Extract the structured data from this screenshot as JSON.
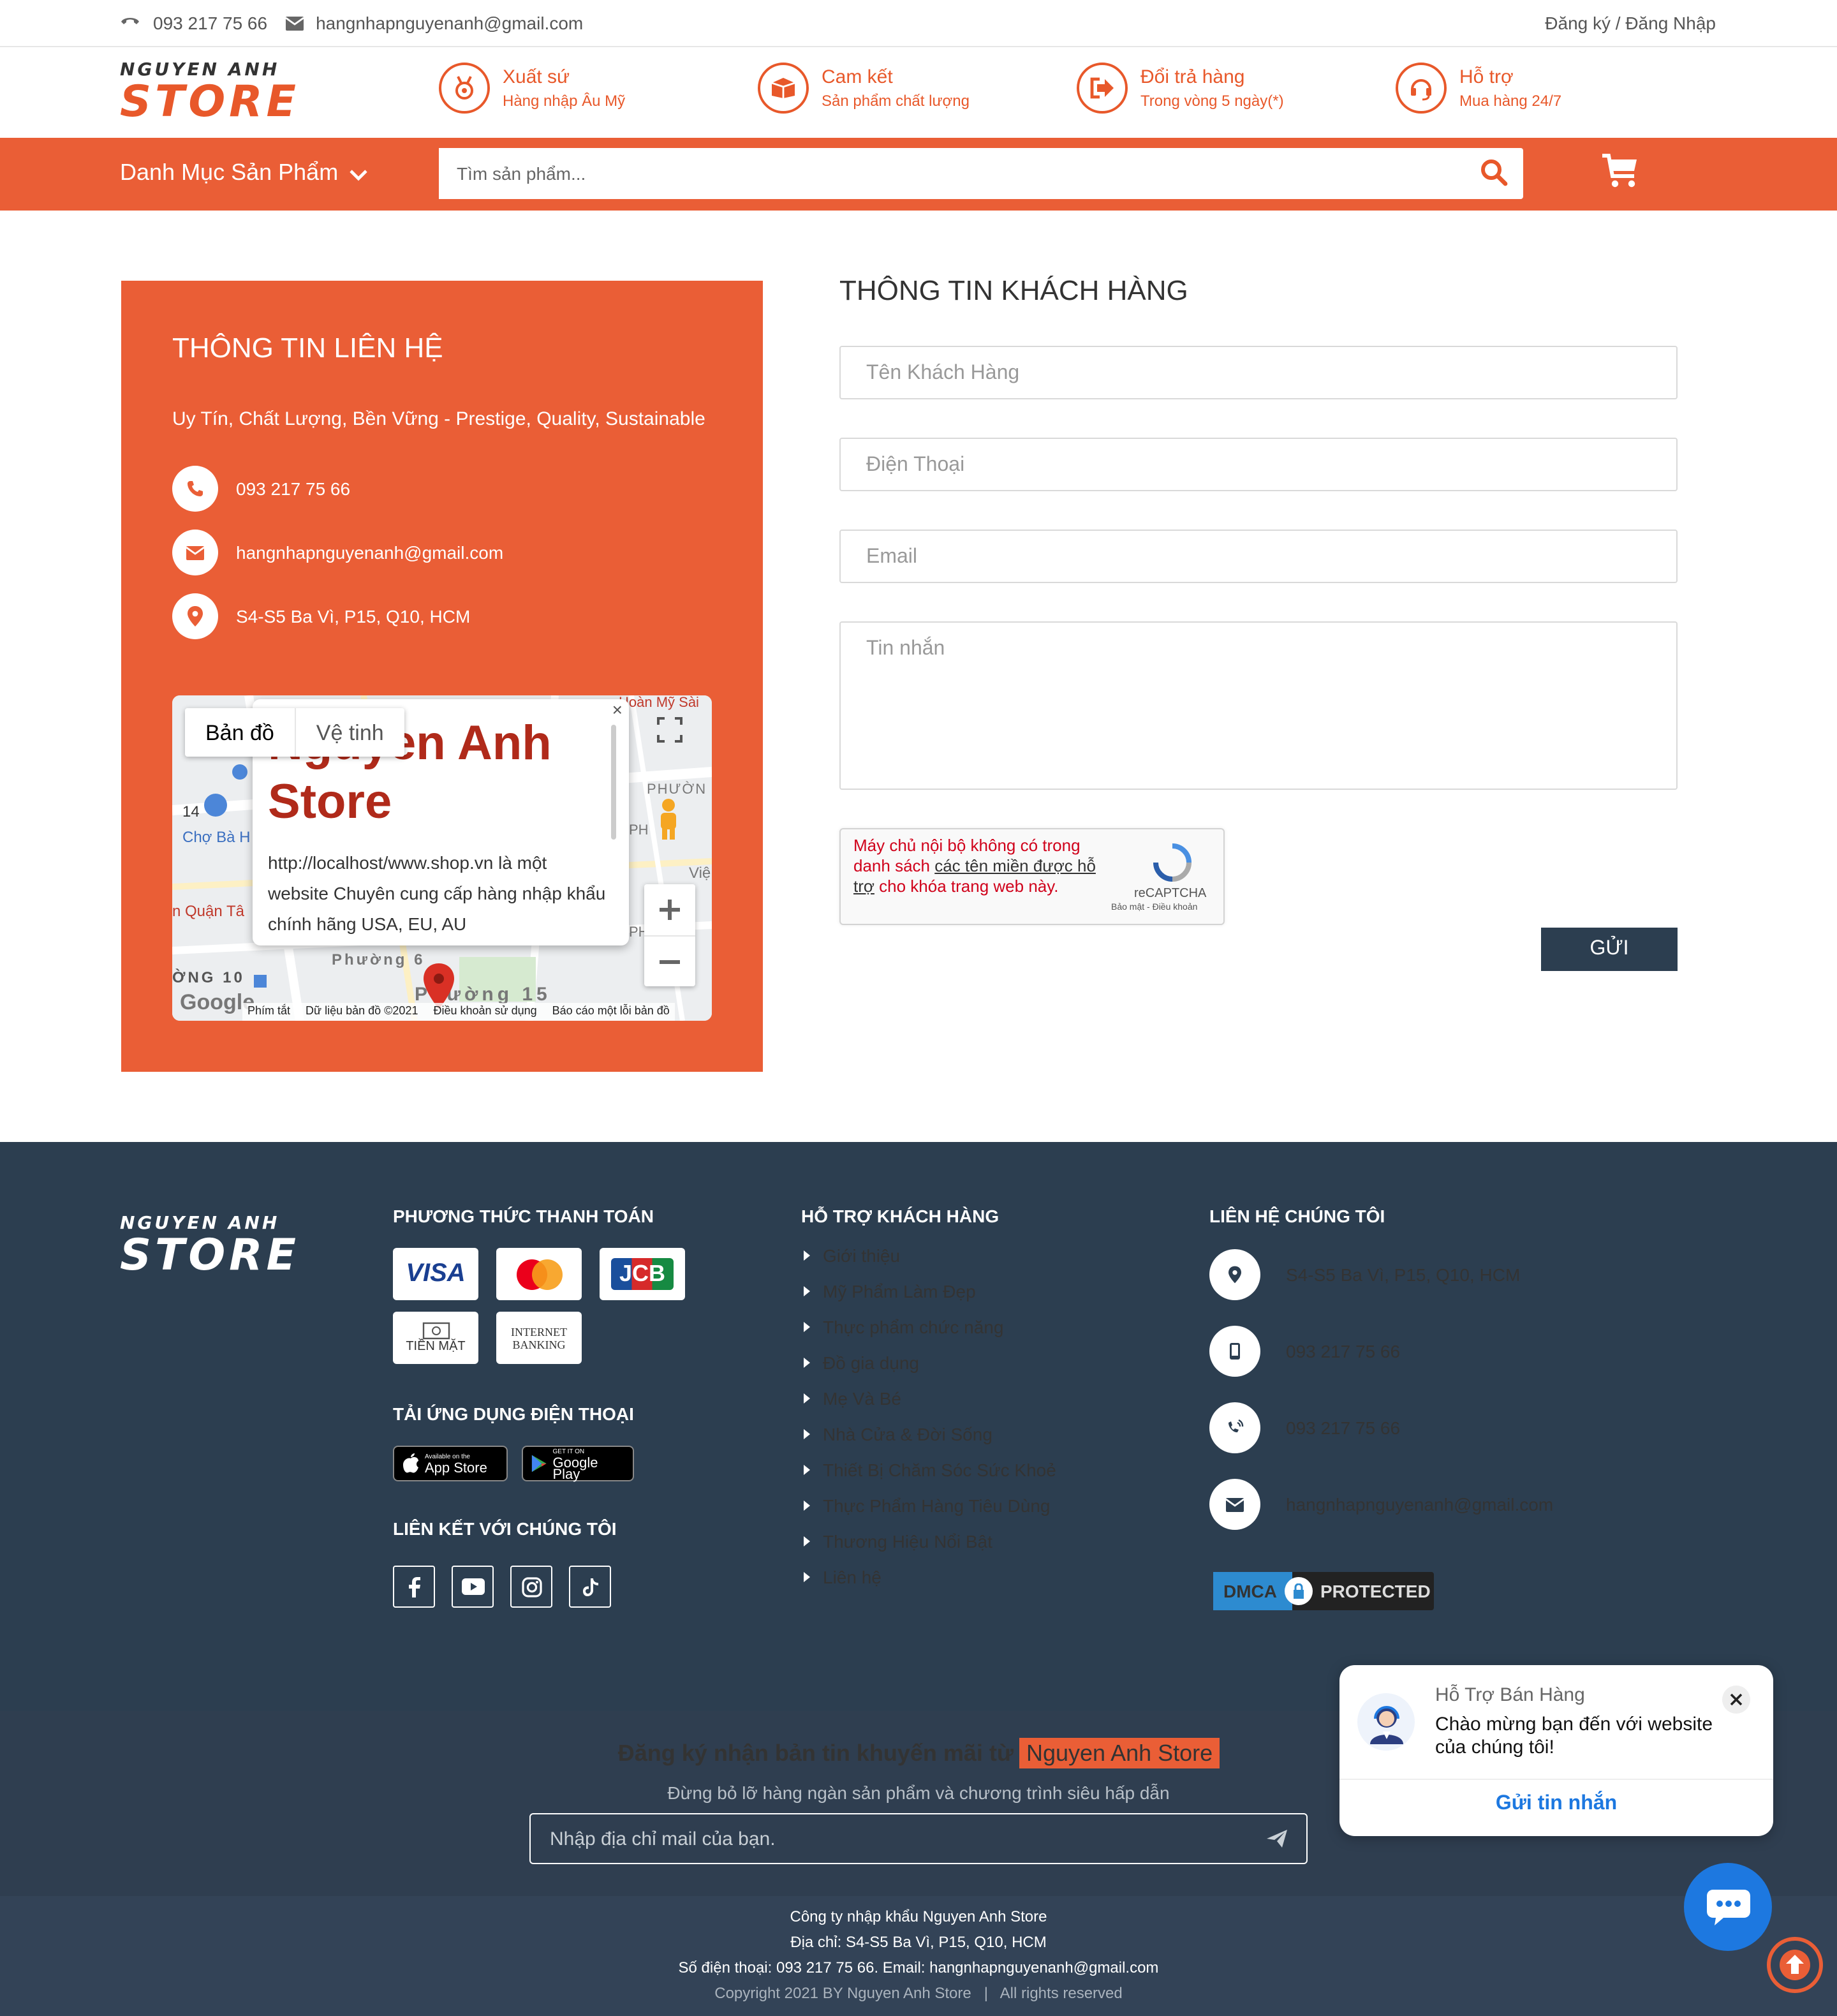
{
  "topbar": {
    "phone": "093 217 75 66",
    "email": "hangnhapnguyenanh@gmail.com",
    "auth": "Đăng ký / Đăng Nhập"
  },
  "logo": {
    "line1": "NGUYEN ANH",
    "line2": "STORE"
  },
  "features": [
    {
      "icon": "medal-icon",
      "title": "Xuất sứ",
      "sub": "Hàng nhập Âu Mỹ"
    },
    {
      "icon": "box-icon",
      "title": "Cam kết",
      "sub": "Sản phẩm chất lượng"
    },
    {
      "icon": "return-icon",
      "title": "Đổi trả hàng",
      "sub": "Trong vòng 5 ngày(*)"
    },
    {
      "icon": "headset-icon",
      "title": "Hỗ trợ",
      "sub": "Mua hàng 24/7"
    }
  ],
  "nav": {
    "category": "Danh Mục Sản Phẩm",
    "search_placeholder": "Tìm sản phẩm..."
  },
  "contact": {
    "title": "THÔNG TIN LIÊN HỆ",
    "tagline": "Uy Tín, Chất Lượng, Bền Vững - Prestige, Quality, Sustainable",
    "phone": "093 217 75 66",
    "email": "hangnhapnguyenanh@gmail.com",
    "address": "S4-S5 Ba Vì, P15, Q10, HCM"
  },
  "map": {
    "tab_map": "Bản đồ",
    "tab_satellite": "Vệ tinh",
    "popup_title": "Nguyen Anh Store",
    "popup_url": "http://localhost/www.shop.vn",
    "popup_text_mid": " là một website ",
    "popup_text_bold": "Chuyên cung cấp hàng nhập khẩu chính hãng USA, EU, AU",
    "labels": [
      "Phường 6",
      "Phường 15",
      "ỜNG 10",
      "Chợ Bà H",
      "n Quận Tâ",
      "Hoàn Mỹ Sài",
      "PHƯỜN",
      "Việ",
      "14",
      "PH",
      "PH"
    ],
    "footer_shortcuts": "Phím tắt",
    "footer_data": "Dữ liệu bản đồ ©2021",
    "footer_terms": "Điều khoản sử dụng",
    "footer_report": "Báo cáo một lỗi bản đồ",
    "google": "Google"
  },
  "form": {
    "title": "THÔNG TIN KHÁCH HÀNG",
    "name_placeholder": "Tên Khách Hàng",
    "phone_placeholder": "Điện Thoại",
    "email_placeholder": "Email",
    "message_placeholder": "Tin nhắn",
    "recaptcha_msg_a": "Máy chủ nội bộ không có trong danh sách ",
    "recaptcha_link": "các tên miền được hỗ trợ",
    "recaptcha_msg_b": " cho khóa trang web này.",
    "recaptcha_brand": "reCAPTCHA",
    "recaptcha_terms": "Bảo mật - Điều khoản",
    "submit": "GỬI"
  },
  "footer": {
    "payment_title": "PHƯƠNG THỨC THANH TOÁN",
    "payments": [
      "VISA",
      "mastercard",
      "JCB",
      "TIỀN MẶT",
      "INTERNET BANKING"
    ],
    "app_title": "TẢI ỨNG DỤNG ĐIỆN THOẠI",
    "appstore_small": "Available on the",
    "appstore_big": "App Store",
    "googleplay_small": "GET IT ON",
    "googleplay_big": "Google Play",
    "social_title": "LIÊN KẾT VỚI CHÚNG TÔI",
    "support_title": "HỖ TRỢ KHÁCH HÀNG",
    "support_links": [
      "Giới thiệu",
      "Mỹ Phẩm Làm Đẹp",
      "Thực phẩm chức năng",
      "Đồ gia dụng",
      "Mẹ Và Bé",
      "Nhà Cửa & Đời Sống",
      "Thiết Bị Chăm Sóc Sức Khoẻ",
      "Thực Phẩm Hàng Tiêu Dùng",
      "Thương Hiệu Nổi Bật",
      "Liên hệ"
    ],
    "contact_title": "LIÊN HỆ CHÚNG TÔI",
    "contact_address": "S4-S5 Ba Vì, P15, Q10, HCM",
    "contact_mobile": "093 217 75 66",
    "contact_phone": "093 217 75 66",
    "contact_email": "hangnhapnguyenanh@gmail.com",
    "dmca_a": "DMCA",
    "dmca_b": "PROTECTED"
  },
  "newsletter": {
    "title": "Đăng ký nhận bản tin khuyến mãi từ",
    "brand": "Nguyen Anh Store",
    "subtitle": "Đừng bỏ lỡ hàng ngàn sản phẩm và chương trình siêu hấp dẫn",
    "placeholder": "Nhập địa chỉ mail của bạn."
  },
  "bottom": {
    "company": "Công ty nhập khẩu Nguyen Anh Store",
    "address": "Địa chỉ: S4-S5 Ba Vì, P15, Q10, HCM",
    "contact": "Số điện thoại: 093 217 75 66. Email: hangnhapnguyenanh@gmail.com",
    "copyright": "Copyright 2021 BY Nguyen Anh Store   |   All rights reserved"
  },
  "chat": {
    "title": "Hỗ Trợ Bán Hàng",
    "message": "Chào mừng bạn đến với website của chúng tôi!",
    "action": "Gửi tin nhắn"
  },
  "colors": {
    "accent": "#ea5e36",
    "dark": "#2c3e50",
    "chat": "#1d78e0"
  }
}
